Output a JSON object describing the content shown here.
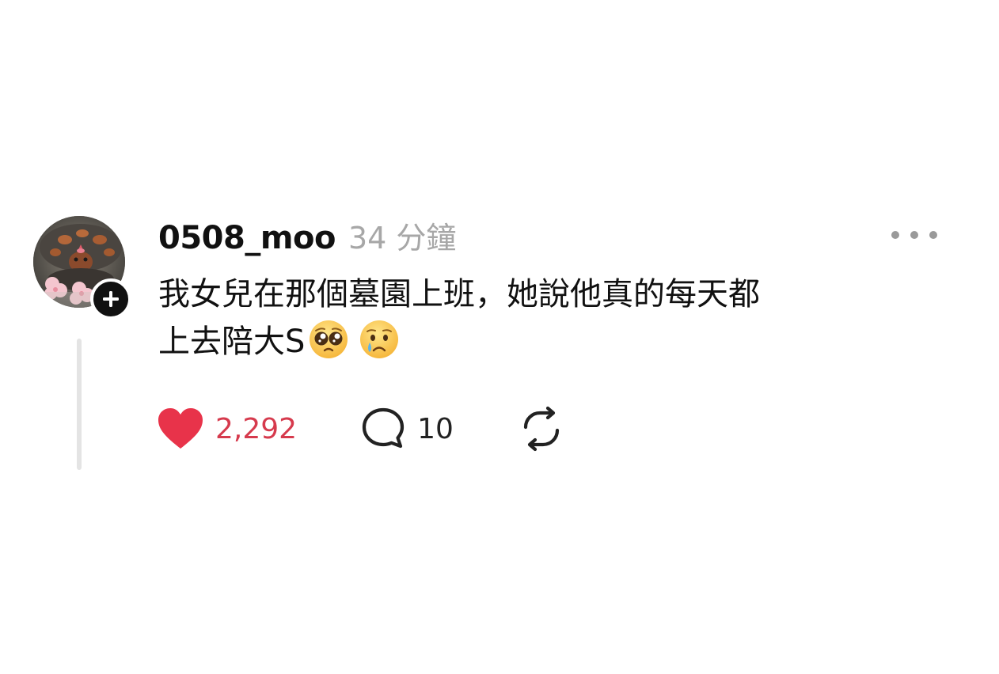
{
  "post": {
    "username": "0508_moo",
    "timestamp": "34 分鐘",
    "text_line_1": "我女兒在那個墓園上班，她說他真的每天都",
    "text_line_2": "上去陪大S",
    "emojis": [
      "pleading-face-emoji",
      "crying-face-emoji"
    ]
  },
  "actions": {
    "likes": "2,292",
    "replies": "10"
  },
  "colors": {
    "like": "#e8334a",
    "like_count": "#d63a4d",
    "timestamp": "#a7a7a7",
    "text": "#111111",
    "thread_line": "#e4e4e4"
  },
  "icons": {
    "avatar": "turtle-with-cherry-blossoms-avatar",
    "follow": "plus-icon",
    "more": "more-horizontal-icon",
    "like": "heart-icon",
    "reply": "speech-bubble-icon",
    "repost": "repost-icon"
  }
}
